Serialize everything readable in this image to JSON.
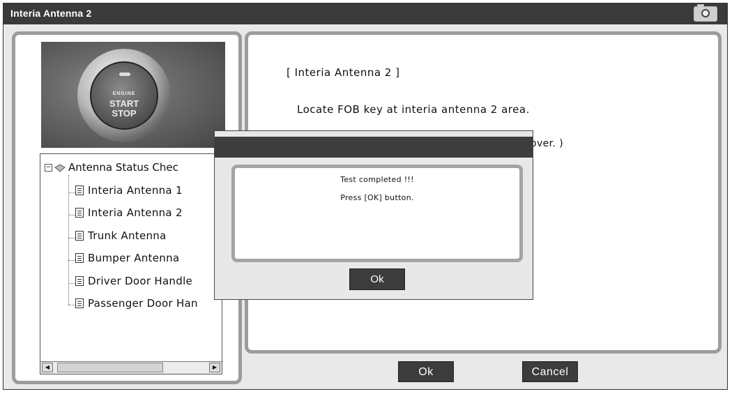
{
  "window": {
    "title": "Interia Antenna 2",
    "camera_icon": "camera-icon"
  },
  "left": {
    "photo_text": [
      "ENGINE",
      "START",
      "STOP"
    ],
    "tree": {
      "root": "Antenna Status Chec",
      "items": [
        "Interia Antenna 1",
        "Interia Antenna 2",
        "Trunk Antenna",
        "Bumper Antenna",
        "Driver Door Handle",
        "Passenger Door Han"
      ]
    }
  },
  "right": {
    "title": "[ Interia Antenna 2 ]",
    "line1": "Locate FOB key at interia antenna 2 area.",
    "line2_visible": "over. )"
  },
  "buttons": {
    "ok": "Ok",
    "cancel": "Cancel"
  },
  "dialog": {
    "message1": "Test completed !!!",
    "message2": "Press [OK] button.",
    "ok": "Ok"
  }
}
